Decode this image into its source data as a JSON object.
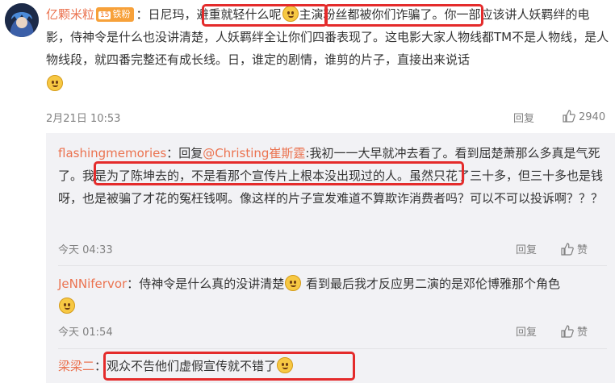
{
  "main_comment": {
    "username": "亿颗米粒",
    "colon": "：",
    "badge_level": "15",
    "badge_text": "铁粉",
    "text_1": "日尼玛，",
    "text_highlight": "避重就轻什么呢",
    "text_highlight_2": "主演粉丝都被你们诈骗了",
    "text_2": "。你一部应该讲人妖羁绊的电影，侍神令是什么也没讲清楚，人妖羁绊全让你们四番表现了。这电影大家人物线都TM不是人物线，是人物线段，就四番完整还有成长线。日，谁定的剧情，谁剪的片子，直接出来说话",
    "time": "2月21日 10:53",
    "reply_label": "回复",
    "like_count": "2940"
  },
  "replies": [
    {
      "username": "flashingmemories",
      "colon": "：",
      "reply_prefix": "回复",
      "at_user": "@Christing崔斯霆",
      "text_1": ":我初一一大早就冲去看了。看到屈楚萧那么多真是气死了",
      "text_highlight": "。我是为了陈坤去的，不是看那个宣传片上根本没出现过的人",
      "text_2": "。虽然只花了三十多，但三十多也是钱呀，也是被骗了才花的冤枉钱啊。像这样的片子宣发难道不算欺诈消费者吗？可以不可以投诉啊？？？",
      "time": "今天 04:33",
      "reply_label": "回复",
      "like_label": "赞"
    },
    {
      "username": "JeNNifervor",
      "colon": "：",
      "text_1": "侍神令是什么真的没讲清楚",
      "text_2": " 看到最后我才反应男二演的是邓伦博雅那个角色",
      "time": "今天 01:54",
      "reply_label": "回复",
      "like_label": "赞"
    },
    {
      "username": "梁梁二",
      "colon": "：",
      "text_highlight": "观众不告他们虚假宣传就不错了"
    }
  ],
  "icons": {
    "thumb": "thumbs-up-icon",
    "emoji": "smile-emoji-icon",
    "laugh": "laugh-emoji-icon"
  },
  "colors": {
    "username": "#eb7350",
    "highlight_box": "#e42b2b",
    "reply_bg": "#f2f2f5"
  }
}
